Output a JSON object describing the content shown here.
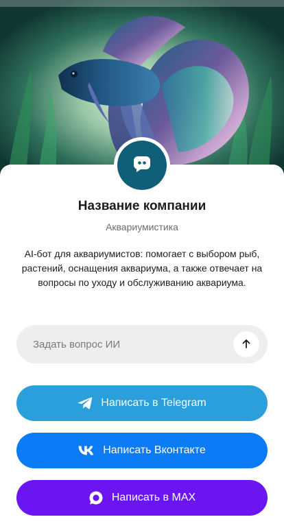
{
  "hero": {
    "image": "betta-fish-aquarium-illustration"
  },
  "profile": {
    "avatar_icon": "chat-bot-icon",
    "name": "Название компании",
    "category": "Аквариумистика",
    "description": "AI-бот для аквариумистов: помогает с выбором рыб, растений, оснащения аквариума, а также отвечает на вопросы по уходу и обслуживанию аквариума."
  },
  "ask": {
    "placeholder": "Задать вопрос ИИ",
    "value": "",
    "send_icon": "arrow-up-icon"
  },
  "actions": [
    {
      "label": "Написать в Telegram",
      "icon": "telegram-icon",
      "color": "#2a9fdc"
    },
    {
      "label": "Написать Вконтакте",
      "icon": "vk-icon",
      "color": "#0b7cf5"
    },
    {
      "label": "Написать в MAX",
      "icon": "max-icon",
      "color": "#6b16f2"
    }
  ],
  "colors": {
    "avatar_bg": "#0f5f78",
    "ask_bg": "#eeeeef"
  }
}
